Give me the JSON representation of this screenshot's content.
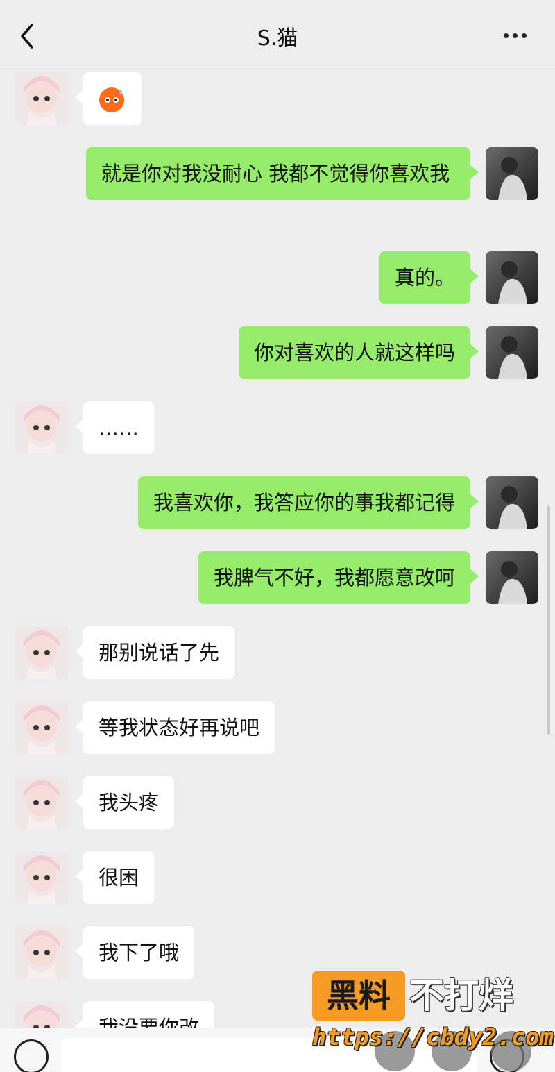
{
  "header": {
    "title": "S.猫",
    "back_icon": "chevron-left-icon",
    "more_icon": "more-dots-icon"
  },
  "messages": [
    {
      "side": "in",
      "type": "emoji",
      "emoji": "sweat-face-emoji"
    },
    {
      "side": "out",
      "text": "就是你对我没耐心 我都不觉得你喜欢我"
    },
    {
      "side": "out",
      "text": "真的。"
    },
    {
      "side": "out",
      "text": "你对喜欢的人就这样吗"
    },
    {
      "side": "in",
      "text": "……"
    },
    {
      "side": "out",
      "text": "我喜欢你，我答应你的事我都记得"
    },
    {
      "side": "out",
      "text": "我脾气不好，我都愿意改呵"
    },
    {
      "side": "in",
      "text": "那别说话了先"
    },
    {
      "side": "in",
      "text": "等我状态好再说吧"
    },
    {
      "side": "in",
      "text": "我头疼"
    },
    {
      "side": "in",
      "text": "很困"
    },
    {
      "side": "in",
      "text": "我下了哦"
    },
    {
      "side": "in",
      "text": "我没要你改"
    }
  ],
  "watermark": {
    "box_text": "黑料",
    "text": "不打烊",
    "url": "https://cbdy2.com"
  },
  "colors": {
    "background": "#ededed",
    "outgoing_bubble": "#95ec69",
    "incoming_bubble": "#ffffff",
    "watermark_orange": "#f59a23"
  }
}
